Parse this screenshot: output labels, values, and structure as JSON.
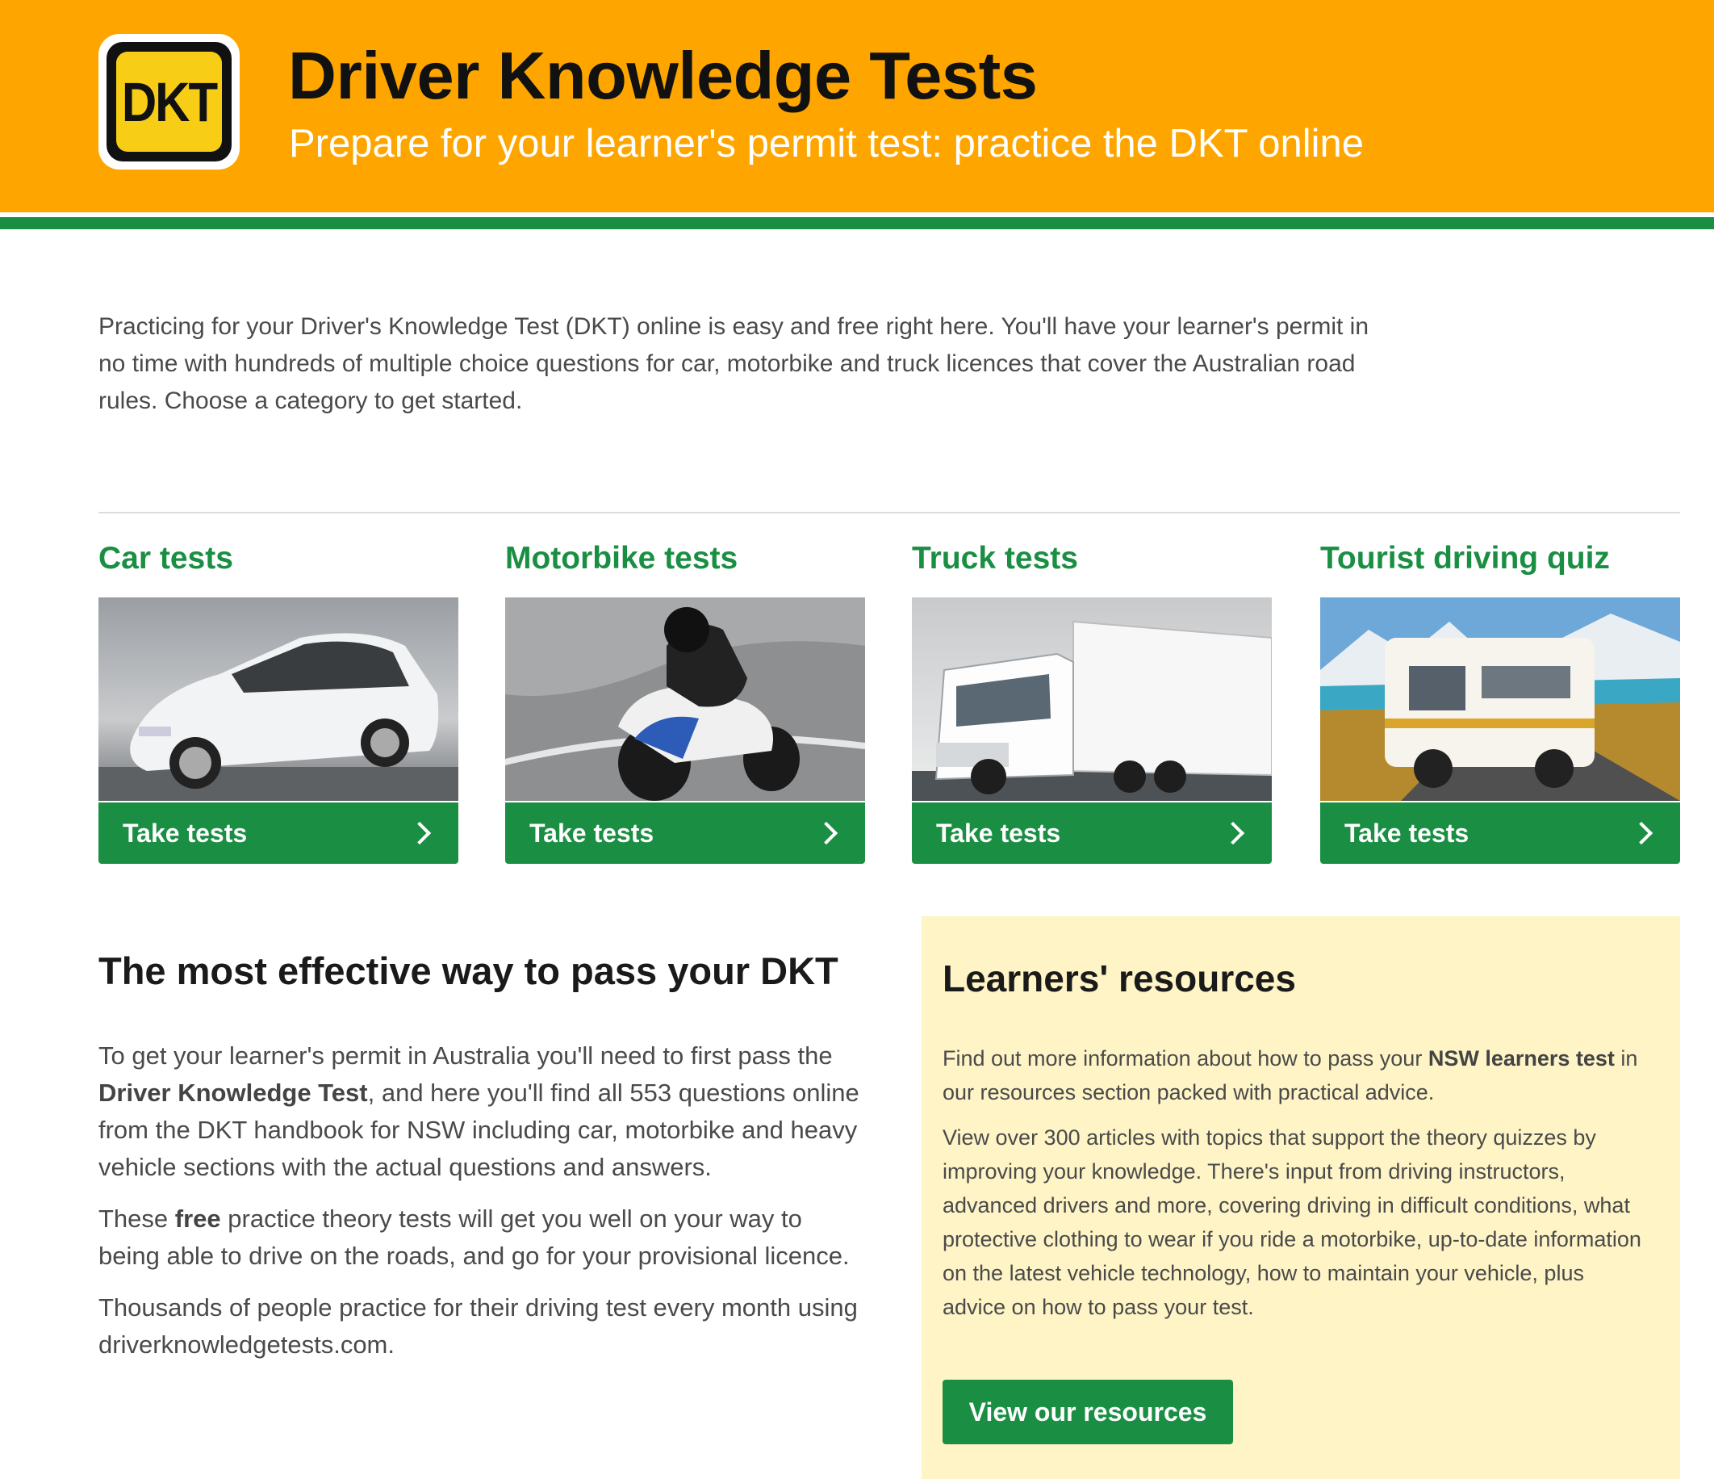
{
  "header": {
    "logo_text": "DKT",
    "title": "Driver Knowledge Tests",
    "subtitle": "Prepare for your learner's permit test: practice the DKT online"
  },
  "intro": {
    "text": "Practicing for your Driver's Knowledge Test (DKT) online is easy and free right here. You'll have your learner's permit in no time with hundreds of multiple choice questions for car, motorbike and truck licences that cover the Australian road rules. Choose a category to get started."
  },
  "categories": [
    {
      "title": "Car tests",
      "button_label": "Take tests",
      "image": "white-hatchback-car"
    },
    {
      "title": "Motorbike tests",
      "button_label": "Take tests",
      "image": "sport-motorbike-rider"
    },
    {
      "title": "Truck tests",
      "button_label": "Take tests",
      "image": "white-semi-truck"
    },
    {
      "title": "Tourist driving quiz",
      "button_label": "Take tests",
      "image": "campervan-on-mountain-road"
    }
  ],
  "effective": {
    "heading": "The most effective way to pass your DKT",
    "p1_a": "To get your learner's permit in Australia you'll need to first pass the ",
    "p1_bold": "Driver Knowledge Test",
    "p1_b": ", and here you'll find all 553 questions online from the DKT handbook for NSW including car, motorbike and heavy vehicle sections with the actual questions and answers.",
    "p2_a": "These ",
    "p2_bold": "free",
    "p2_b": " practice theory tests will get you well on your way to being able to drive on the roads, and go for your provisional licence.",
    "p3": "Thousands of people practice for their driving test every month using driverknowledgetests.com."
  },
  "resources": {
    "heading": "Learners' resources",
    "p1_a": "Find out more information about how to pass your ",
    "p1_bold": "NSW learners test",
    "p1_b": " in our resources section packed with practical advice.",
    "p2": "View over 300 articles with topics that support the theory quizzes by improving your knowledge. There's input from driving instructors, advanced drivers and more, covering driving in difficult conditions, what protective clothing to wear if you ride a motorbike, up-to-date information on the latest vehicle technology, how to maintain your vehicle, plus advice on how to pass your test.",
    "button_label": "View our resources"
  },
  "colors": {
    "header_orange": "#fea500",
    "brand_green": "#1a8f43",
    "logo_yellow": "#f7cd16",
    "resources_bg": "#fef4c6"
  }
}
